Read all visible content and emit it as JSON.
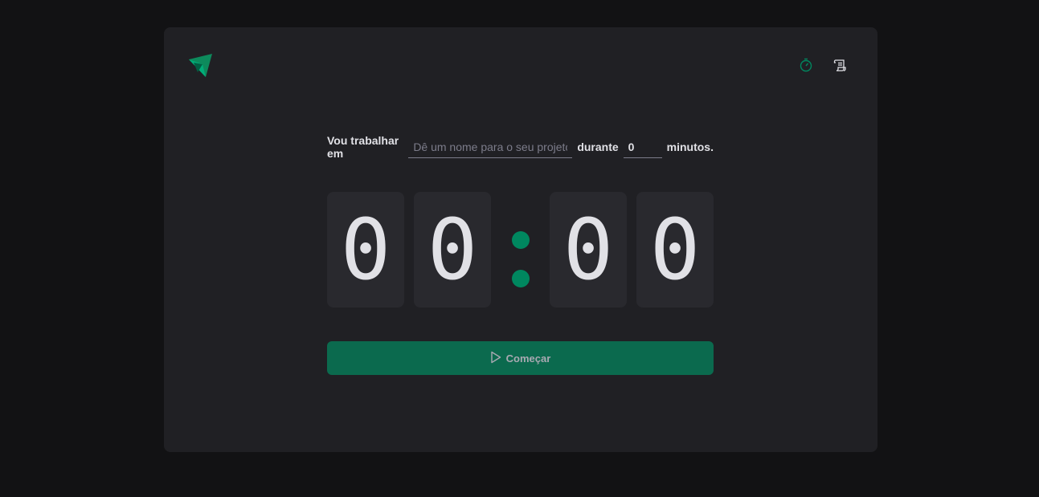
{
  "header": {
    "logo_icon": "ignite-logo-icon",
    "nav": [
      {
        "icon": "timer-icon",
        "active": true
      },
      {
        "icon": "scroll-history-icon",
        "active": false
      }
    ]
  },
  "form": {
    "label_before": "Vou trabalhar em",
    "project_placeholder": "Dê um nome para o seu projeto",
    "project_value": "",
    "label_middle": "durante",
    "minutes_value": "0",
    "label_after": "minutos."
  },
  "countdown": {
    "minutes_tens": "0",
    "minutes_ones": "0",
    "separator": ":",
    "seconds_tens": "0",
    "seconds_ones": "0"
  },
  "start_button": {
    "label": "Começar",
    "icon": "play-icon"
  },
  "colors": {
    "background": "#121214",
    "card": "#202024",
    "digit_bg": "#29292e",
    "accent": "#00875f",
    "button": "#0b6a4e",
    "text": "#e1e1e6",
    "placeholder": "#7c7c8a"
  }
}
